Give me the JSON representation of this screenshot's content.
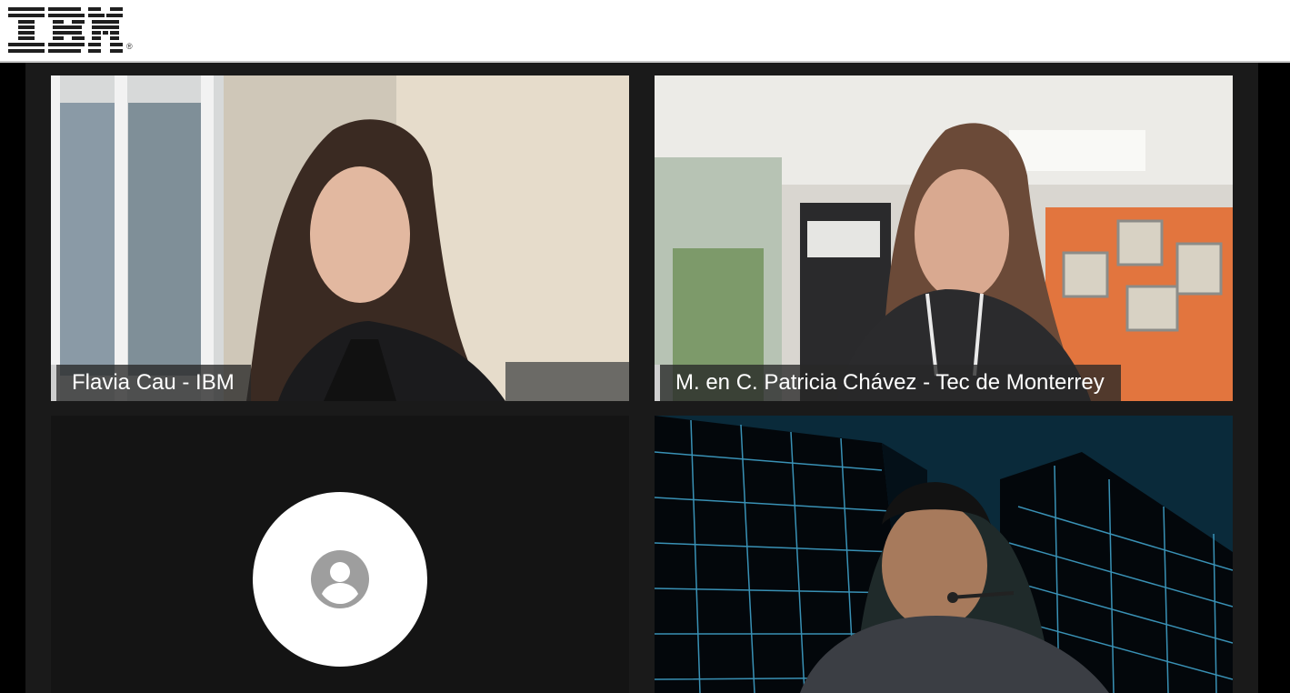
{
  "brand": {
    "logo_text": "IBM",
    "registered_mark": "®"
  },
  "participants": [
    {
      "name": "Flavia Cau - IBM",
      "video": "on"
    },
    {
      "name": "M. en C. Patricia Chávez - Tec de Monterrey",
      "video": "on"
    },
    {
      "name": "",
      "video": "off",
      "placeholder_icon": "account-circle-icon"
    },
    {
      "name": "",
      "video": "on"
    }
  ],
  "colors": {
    "stage_background": "#000000",
    "tile_background": "#1a1a1a",
    "nameplate_accent": "#cfcfcf",
    "avatar_background": "#ffffff",
    "avatar_icon": "#9e9e9e"
  }
}
